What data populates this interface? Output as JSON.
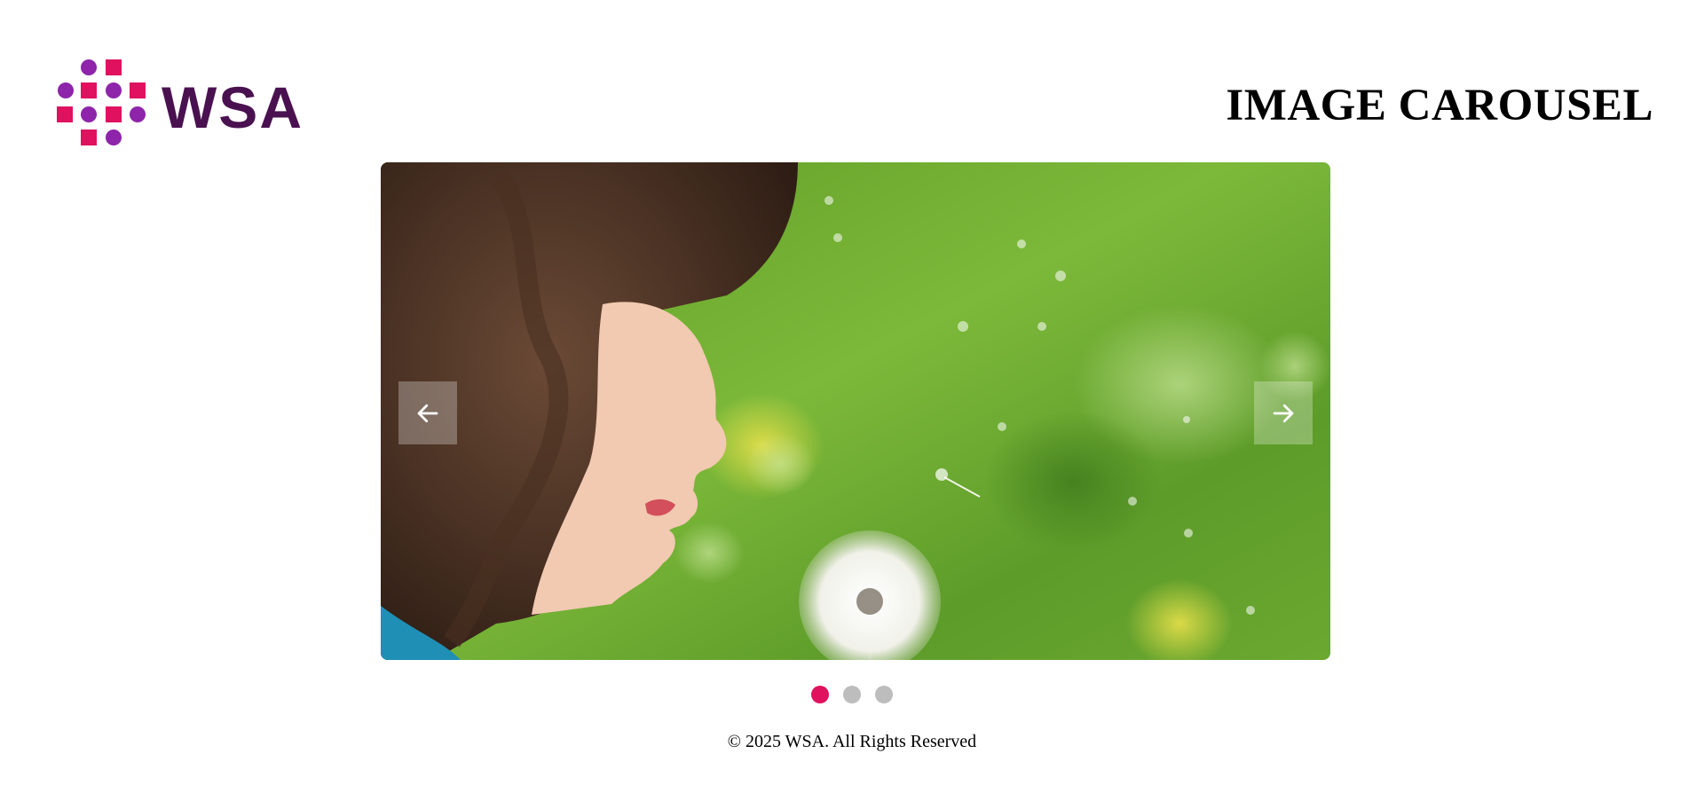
{
  "header": {
    "logo": {
      "text": "WSA",
      "alt": "WSA logo",
      "icon": "dot-grid-logo-icon"
    },
    "title": "IMAGE CAROUSEL"
  },
  "carousel": {
    "active_index": 0,
    "slide_count": 3,
    "slide_alt": "Child blowing a dandelion in a green field",
    "prev_label": "Previous slide",
    "next_label": "Next slide",
    "prev_icon": "arrow-left-icon",
    "next_icon": "arrow-right-icon",
    "dots": [
      {
        "label": "Go to slide 1",
        "active": true
      },
      {
        "label": "Go to slide 2",
        "active": false
      },
      {
        "label": "Go to slide 3",
        "active": false
      }
    ]
  },
  "footer": {
    "text": "© 2025 WSA. All Rights Reserved"
  },
  "colors": {
    "brand_magenta": "#e0115f",
    "brand_purple": "#8e24aa",
    "brand_dark_purple": "#4a1150",
    "dot_inactive": "#bdbdbd",
    "dot_active": "#e0115f"
  }
}
